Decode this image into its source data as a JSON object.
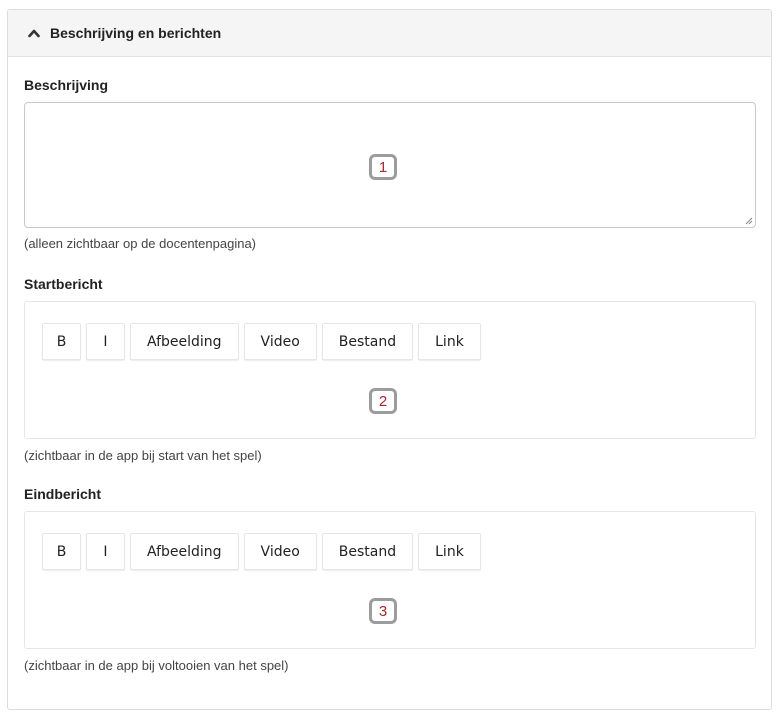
{
  "panel": {
    "title": "Beschrijving en berichten"
  },
  "description": {
    "label": "Beschrijving",
    "value": "",
    "help": "(alleen zichtbaar op de docentenpagina)",
    "marker": "1"
  },
  "start_message": {
    "label": "Startbericht",
    "toolbar": [
      "B",
      "I",
      "Afbeelding",
      "Video",
      "Bestand",
      "Link"
    ],
    "help": "(zichtbaar in de app bij start van het spel)",
    "marker": "2"
  },
  "end_message": {
    "label": "Eindbericht",
    "toolbar": [
      "B",
      "I",
      "Afbeelding",
      "Video",
      "Bestand",
      "Link"
    ],
    "help": "(zichtbaar in de app bij voltooien van het spel)",
    "marker": "3"
  },
  "colors": {
    "marker_border": "#9c9c9c",
    "marker_text": "#a52a2a",
    "header_bg": "#f5f5f5"
  }
}
